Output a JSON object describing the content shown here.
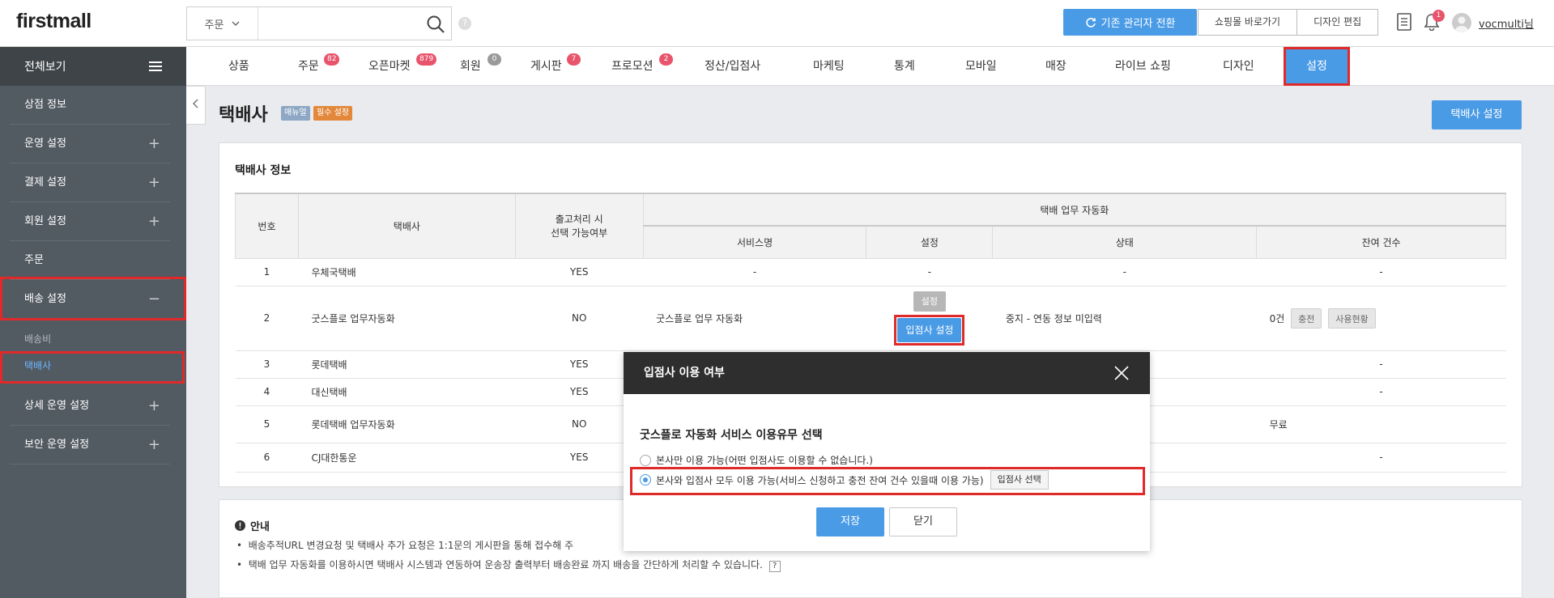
{
  "header": {
    "logo": "firstmall",
    "search_category": "주문",
    "search_placeholder": "",
    "help": "?",
    "switch_admin_label": "기존 관리자 전환",
    "shop_shortcut_label": "쇼핑몰 바로가기",
    "design_edit_label": "디자인 편집",
    "notification_count": "1",
    "username": "vocmulti님"
  },
  "nav": {
    "all_menu": "전체보기",
    "items": [
      {
        "label": "상품",
        "badge": ""
      },
      {
        "label": "주문",
        "badge": "82"
      },
      {
        "label": "오픈마켓",
        "badge": "879"
      },
      {
        "label": "회원",
        "badge": "0"
      },
      {
        "label": "게시판",
        "badge": "7"
      },
      {
        "label": "프로모션",
        "badge": "2"
      },
      {
        "label": "정산/입점사",
        "badge": ""
      },
      {
        "label": "마케팅",
        "badge": ""
      },
      {
        "label": "통계",
        "badge": ""
      },
      {
        "label": "모바일",
        "badge": ""
      },
      {
        "label": "매장",
        "badge": ""
      },
      {
        "label": "라이브 쇼핑",
        "badge": ""
      },
      {
        "label": "디자인",
        "badge": ""
      },
      {
        "label": "설정",
        "badge": ""
      }
    ]
  },
  "sidebar": {
    "items": [
      {
        "label": "상점 정보",
        "expand": ""
      },
      {
        "label": "운영 설정",
        "expand": "+"
      },
      {
        "label": "결제 설정",
        "expand": "+"
      },
      {
        "label": "회원 설정",
        "expand": "+"
      },
      {
        "label": "주문",
        "expand": ""
      },
      {
        "label": "배송 설정",
        "expand": "−"
      },
      {
        "label": "상세 운영 설정",
        "expand": "+"
      },
      {
        "label": "보안 운영 설정",
        "expand": "+"
      }
    ],
    "sub_items": [
      "배송비",
      "택배사"
    ]
  },
  "page": {
    "title": "택배사",
    "tag_manual": "매뉴얼",
    "tag_required": "필수 설정",
    "setting_button": "택배사 설정",
    "section_title": "택배사 정보"
  },
  "table": {
    "headers": {
      "no": "번호",
      "courier": "택배사",
      "shipping_select": "출고처리 시",
      "shipping_select2": "선택 가능여부",
      "automation": "택배 업무 자동화",
      "service_name": "서비스명",
      "setting": "설정",
      "status": "상태",
      "remaining": "잔여 건수"
    },
    "rows": [
      {
        "no": "1",
        "courier": "우체국택배",
        "select": "YES",
        "service": "-",
        "setting": "-",
        "status": "-",
        "remaining": "-"
      },
      {
        "no": "2",
        "courier": "굿스플로 업무자동화",
        "select": "NO",
        "service": "굿스플로 업무 자동화",
        "setting": "설정",
        "setting2": "입점사 설정",
        "status": "중지 - 연동 정보 미입력",
        "remaining": "0건",
        "charge": "충전",
        "usage": "사용현황"
      },
      {
        "no": "3",
        "courier": "롯데택배",
        "select": "YES",
        "service": "",
        "setting": "",
        "status": "",
        "remaining": "-"
      },
      {
        "no": "4",
        "courier": "대신택배",
        "select": "YES",
        "service": "",
        "setting": "",
        "status": "",
        "remaining": "-"
      },
      {
        "no": "5",
        "courier": "롯데택배 업무자동화",
        "select": "NO",
        "service": "",
        "setting": "",
        "status": "",
        "remaining": "무료"
      },
      {
        "no": "6",
        "courier": "CJ대한통운",
        "select": "YES",
        "service": "",
        "setting": "",
        "status": "",
        "remaining": "-"
      }
    ]
  },
  "notice": {
    "title": "안내",
    "line1": "배송추적URL 변경요청 및 택배사 추가 요청은 1:1문의 게시판을 통해 접수해 주",
    "line2": "택배 업무 자동화를 이용하시면 택배사 시스템과 연동하여 운송장 출력부터 배송완료 까지 배송을 간단하게 처리할 수 있습니다.",
    "help": "?"
  },
  "modal": {
    "title": "입점사 이용 여부",
    "subtitle": "굿스플로 자동화 서비스 이용유무 선택",
    "option1": "본사만 이용 가능(어떤 입점사도 이용할 수 없습니다.)",
    "option2": "본사와 입점사 모두 이용 가능(서비스 신청하고 충전 잔여 건수 있을때 이용 가능)",
    "select_store": "입점사 선택",
    "save": "저장",
    "close": "닫기"
  },
  "colors": {
    "accent": "#4a9be6",
    "highlight": "#e02a2a",
    "sidebar": "#525a62"
  }
}
